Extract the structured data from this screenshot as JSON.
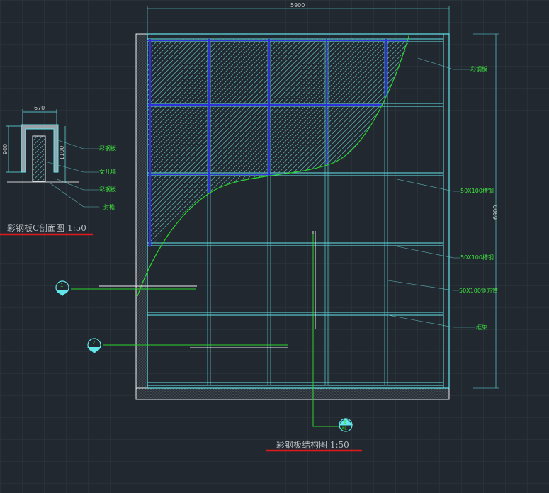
{
  "colors": {
    "background": "#212830",
    "grid": "#2f3741",
    "cyan": "#63e6ea",
    "hatch_blue": "#2d2fd8",
    "green": "#2bd52b",
    "red_underline": "#e01919",
    "leader": "#5fb7b7"
  },
  "section": {
    "dim_width": "670",
    "dim_height_outer": "900",
    "dim_height_inner": "1100",
    "labels": [
      "彩钢板",
      "女儿墙",
      "彩钢板",
      "封檐"
    ],
    "title": "彩钢板C剖面图 1:50"
  },
  "elevation": {
    "dim_top": "5900",
    "dim_right": "6900",
    "labels": [
      "彩钢板",
      "50X100槽钢",
      "50X100槽钢",
      "50X100矩方管",
      "框架"
    ],
    "title": "彩钢板结构图 1:50"
  },
  "markers": {
    "m1_top": "1",
    "m2_top": "2",
    "m3_top": "B",
    "m3_bottom": "A5"
  }
}
